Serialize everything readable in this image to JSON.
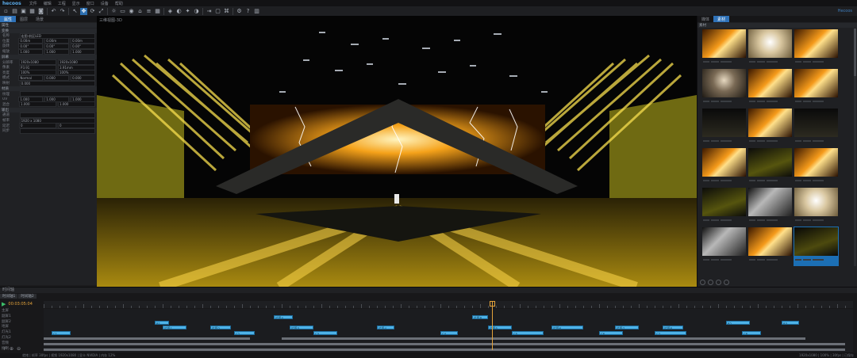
{
  "app": {
    "title": "hecoos",
    "menu": [
      "文件",
      "编辑",
      "工程",
      "显示",
      "窗口",
      "设备",
      "帮助"
    ],
    "right_label": "Hecoos"
  },
  "toolbar": {
    "icons": [
      "new-icon",
      "open-icon",
      "save-icon",
      "save-as-icon",
      "screenshot-icon",
      "sep",
      "undo-icon",
      "redo-icon",
      "sep",
      "select-icon",
      "move-icon",
      "rotate-icon",
      "scale-icon",
      "sep",
      "light-icon",
      "screen-icon",
      "camera-icon",
      "stage-icon",
      "layer-icon",
      "grid-icon",
      "sep",
      "render-icon",
      "view-icon",
      "fx-icon",
      "mask-icon",
      "sep",
      "output-icon",
      "device-icon",
      "network-icon",
      "sep",
      "settings-icon",
      "help-icon",
      "layout-icon"
    ],
    "active_index": 10
  },
  "left_panel": {
    "tabs": [
      "属性",
      "图层",
      "场景"
    ],
    "active_tab": 0,
    "title": "属性",
    "sections": [
      {
        "header": "变换",
        "rows": [
          {
            "label": "名称",
            "fields": [
              "宏图-前区LED"
            ]
          },
          {
            "label": "位置",
            "fields": [
              "0.00m",
              "0.00m",
              "0.00m"
            ]
          },
          {
            "label": "旋转",
            "fields": [
              "0.00°",
              "0.00°",
              "0.00°"
            ]
          },
          {
            "label": "缩放",
            "fields": [
              "1.000",
              "1.000",
              "1.000"
            ]
          }
        ]
      },
      {
        "header": "屏幕",
        "rows": [
          {
            "label": "分辨率",
            "fields": [
              "1920x1080",
              "1920x1080"
            ]
          },
          {
            "label": "像素",
            "fields": [
              "P3.91",
              "3.91mm"
            ]
          },
          {
            "label": "亮度",
            "fields": [
              "100%",
              "100%"
            ]
          },
          {
            "label": "模式",
            "fields": [
              "Normal",
              "0.000",
              "0.000"
            ]
          },
          {
            "label": "映射",
            "fields": [
              "0.000"
            ]
          }
        ]
      },
      {
        "header": "材质",
        "rows": [
          {
            "label": "纹理",
            "fields": [
              ""
            ]
          },
          {
            "label": "UV",
            "fields": [
              "1.000",
              "1.000",
              "1.000"
            ]
          },
          {
            "label": "混合",
            "fields": [
              "1.000",
              "1.000"
            ]
          }
        ]
      },
      {
        "header": "输出",
        "rows": [
          {
            "label": "通道",
            "fields": [
              ""
            ]
          },
          {
            "label": "帧率",
            "fields": [
              "1920 x 1080"
            ]
          },
          {
            "label": "延迟",
            "fields": [
              "0",
              "0"
            ]
          },
          {
            "label": "同步",
            "fields": [
              ""
            ]
          }
        ]
      }
    ]
  },
  "viewport": {
    "label": "三维视图-3D"
  },
  "right_panel": {
    "tabs": [
      "媒体",
      "素材"
    ],
    "active_tab": 1,
    "title": "素材",
    "selected_index": 17,
    "thumbs": [
      "fire",
      "singer-light",
      "fire",
      "singer-dark",
      "fire",
      "fire",
      "dark",
      "fire",
      "dark",
      "fire",
      "stage",
      "fire",
      "stage",
      "lightning",
      "singer-light",
      "lightning",
      "fire",
      "stage-blue"
    ]
  },
  "timeline": {
    "title": "时间轴",
    "tabs": [
      "时间轴1",
      "时间轴2"
    ],
    "timecode": "00:03:05:04",
    "tracks": [
      "主屏",
      "副屏1",
      "副屏2",
      "地屏",
      "灯光1",
      "灯光2",
      "音频",
      "控制"
    ],
    "status_text": "就绪 | 帧率 30fps | 视频 1920x1080 | 显卡 NVIDIA | 内存 12%",
    "status_right": "1920x1080 | 100% | 30fps | 已保存",
    "clips": [
      {
        "track": 1,
        "start": 290,
        "width": 24,
        "label": "片段A"
      },
      {
        "track": 1,
        "start": 540,
        "width": 20,
        "label": "片段B"
      },
      {
        "track": 2,
        "start": 140,
        "width": 18,
        "label": "B1"
      },
      {
        "track": 2,
        "start": 860,
        "width": 30,
        "label": "B2"
      },
      {
        "track": 2,
        "start": 930,
        "width": 22,
        "label": "B3"
      },
      {
        "track": 3,
        "start": 150,
        "width": 30,
        "label": "片段1"
      },
      {
        "track": 3,
        "start": 210,
        "width": 26,
        "label": "片段2"
      },
      {
        "track": 3,
        "start": 310,
        "width": 30,
        "label": "片段3"
      },
      {
        "track": 3,
        "start": 420,
        "width": 22,
        "label": "片段4"
      },
      {
        "track": 3,
        "start": 560,
        "width": 30,
        "label": "片段5"
      },
      {
        "track": 3,
        "start": 640,
        "width": 40,
        "label": "片段6"
      },
      {
        "track": 3,
        "start": 720,
        "width": 30,
        "label": "片段7"
      },
      {
        "track": 3,
        "start": 780,
        "width": 26,
        "label": "片段8"
      },
      {
        "track": 4,
        "start": 10,
        "width": 24,
        "label": "C1"
      },
      {
        "track": 4,
        "start": 240,
        "width": 26,
        "label": "C2"
      },
      {
        "track": 4,
        "start": 340,
        "width": 30,
        "label": "C3"
      },
      {
        "track": 4,
        "start": 500,
        "width": 22,
        "label": "C4"
      },
      {
        "track": 4,
        "start": 590,
        "width": 40,
        "label": "C5"
      },
      {
        "track": 4,
        "start": 700,
        "width": 30,
        "label": "C6"
      },
      {
        "track": 4,
        "start": 770,
        "width": 40,
        "label": "C7"
      },
      {
        "track": 4,
        "start": 880,
        "width": 24,
        "label": "C8"
      },
      {
        "track": 5,
        "start": 0,
        "width": 260,
        "label": ""
      },
      {
        "track": 5,
        "start": 300,
        "width": 660,
        "label": ""
      },
      {
        "track": 6,
        "start": 0,
        "width": 1010,
        "label": ""
      },
      {
        "track": 7,
        "start": 0,
        "width": 1010,
        "label": ""
      }
    ]
  },
  "colors": {
    "accent": "#2f72b8",
    "clip": "#4fb3e8",
    "playhead": "#e2a23a"
  }
}
